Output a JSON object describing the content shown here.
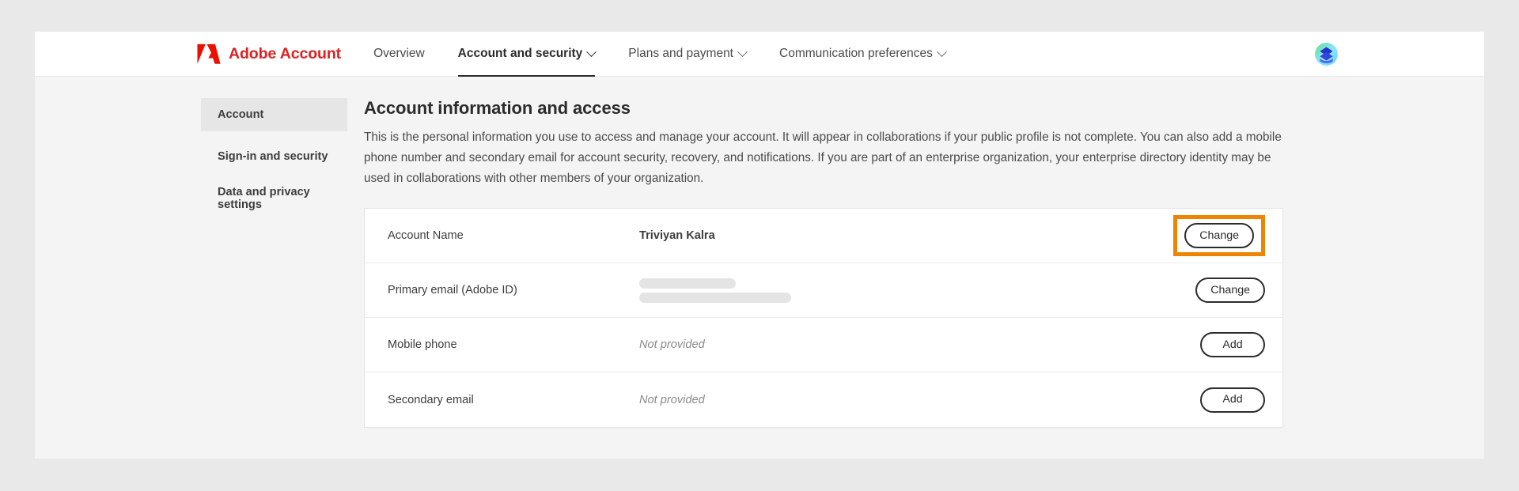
{
  "brand": {
    "name": "Adobe Account",
    "logo_icon": "adobe-logo",
    "logo_color": "#e02020"
  },
  "topnav": {
    "items": [
      {
        "label": "Overview",
        "active": false,
        "has_chevron": false
      },
      {
        "label": "Account and security",
        "active": true,
        "has_chevron": true
      },
      {
        "label": "Plans and payment",
        "active": false,
        "has_chevron": true
      },
      {
        "label": "Communication preferences",
        "active": false,
        "has_chevron": true
      }
    ],
    "avatar_icon": "user-avatar-icon"
  },
  "sidebar": {
    "items": [
      {
        "label": "Account",
        "selected": true
      },
      {
        "label": "Sign-in and security",
        "selected": false
      },
      {
        "label": "Data and privacy settings",
        "selected": false
      }
    ]
  },
  "main": {
    "title": "Account information and access",
    "description": "This is the personal information you use to access and manage your account. It will appear in collaborations if your public profile is not complete. You can also add a mobile phone number and secondary email for account security, recovery, and notifications. If you are part of an enterprise organization, your enterprise directory identity may be used in collaborations with other members of your organization.",
    "rows": [
      {
        "label": "Account Name",
        "value": "Triviyan Kalra",
        "value_style": "bold",
        "action_label": "Change",
        "highlighted": true
      },
      {
        "label": "Primary email (Adobe ID)",
        "value": "",
        "value_style": "redacted",
        "action_label": "Change",
        "highlighted": false
      },
      {
        "label": "Mobile phone",
        "value": "Not provided",
        "value_style": "muted",
        "action_label": "Add",
        "highlighted": false
      },
      {
        "label": "Secondary email",
        "value": "Not provided",
        "value_style": "muted",
        "action_label": "Add",
        "highlighted": false
      }
    ]
  },
  "colors": {
    "accent_highlight": "#ee8400",
    "brand_red": "#e02020",
    "page_background": "#f4f4f4",
    "outer_background": "#e9e9e9"
  }
}
